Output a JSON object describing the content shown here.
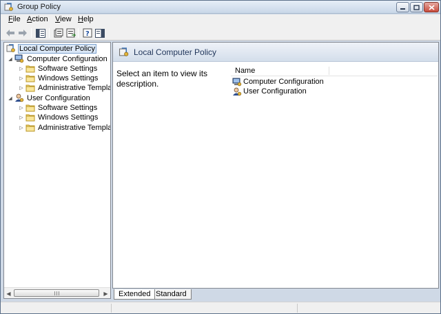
{
  "window": {
    "title": "Group Policy",
    "icon": "group-policy-icon"
  },
  "menu": {
    "items": [
      {
        "key": "F",
        "rest": "ile"
      },
      {
        "key": "A",
        "rest": "ction"
      },
      {
        "key": "V",
        "rest": "iew"
      },
      {
        "key": "H",
        "rest": "elp"
      }
    ]
  },
  "toolbar": {
    "buttons": [
      "back-icon",
      "forward-icon",
      "show-hide-tree-icon",
      "properties-icon",
      "export-list-icon",
      "help-icon",
      "show-hide-action-pane-icon"
    ]
  },
  "tree": {
    "root": {
      "label": "Local Computer Policy"
    },
    "computer": {
      "label": "Computer Configuration",
      "children": [
        "Software Settings",
        "Windows Settings",
        "Administrative Template"
      ]
    },
    "user": {
      "label": "User Configuration",
      "children": [
        "Software Settings",
        "Windows Settings",
        "Administrative Template"
      ]
    }
  },
  "right_pane": {
    "header": "Local Computer Policy",
    "description": "Select an item to view its description.",
    "columns": [
      "Name"
    ],
    "items": [
      "Computer Configuration",
      "User Configuration"
    ]
  },
  "tabs": [
    "Extended",
    "Standard"
  ],
  "colors": {
    "title_gradient_top": "#e6eef7",
    "header_gradient_bottom": "#d4deeb",
    "folder_yellow": "#f6dc7a",
    "selection_border": "#7da2ce"
  }
}
